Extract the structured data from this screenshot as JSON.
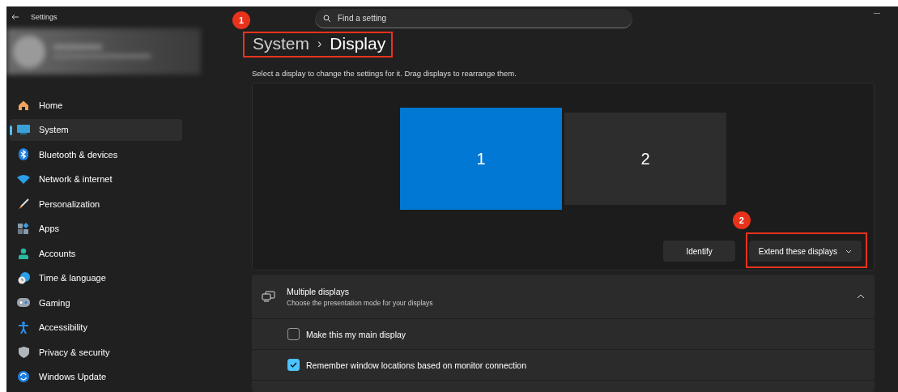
{
  "window": {
    "title": "Settings"
  },
  "search": {
    "placeholder": "Find a setting"
  },
  "sidebar": {
    "items": [
      {
        "label": "Home",
        "kind": "home",
        "selected": false
      },
      {
        "label": "System",
        "kind": "system",
        "selected": true
      },
      {
        "label": "Bluetooth & devices",
        "kind": "bluetooth",
        "selected": false
      },
      {
        "label": "Network & internet",
        "kind": "network",
        "selected": false
      },
      {
        "label": "Personalization",
        "kind": "brush",
        "selected": false
      },
      {
        "label": "Apps",
        "kind": "apps",
        "selected": false
      },
      {
        "label": "Accounts",
        "kind": "accounts",
        "selected": false
      },
      {
        "label": "Time & language",
        "kind": "time",
        "selected": false
      },
      {
        "label": "Gaming",
        "kind": "gaming",
        "selected": false
      },
      {
        "label": "Accessibility",
        "kind": "accessibility",
        "selected": false
      },
      {
        "label": "Privacy & security",
        "kind": "privacy",
        "selected": false
      },
      {
        "label": "Windows Update",
        "kind": "update",
        "selected": false
      }
    ]
  },
  "breadcrumb": {
    "parent": "System",
    "separator": "›",
    "current": "Display",
    "annotation": "1"
  },
  "description": "Select a display to change the settings for it. Drag displays to rearrange them.",
  "displays": [
    {
      "label": "1",
      "selected": true
    },
    {
      "label": "2",
      "selected": false
    }
  ],
  "identify_button": "Identify",
  "display_mode": {
    "value": "Extend these displays",
    "annotation": "2"
  },
  "multiple_displays": {
    "title": "Multiple displays",
    "subtitle": "Choose the presentation mode for your displays",
    "expanded": true,
    "options": [
      {
        "label": "Make this my main display",
        "checked": false
      },
      {
        "label": "Remember window locations based on monitor connection",
        "checked": true
      }
    ]
  }
}
